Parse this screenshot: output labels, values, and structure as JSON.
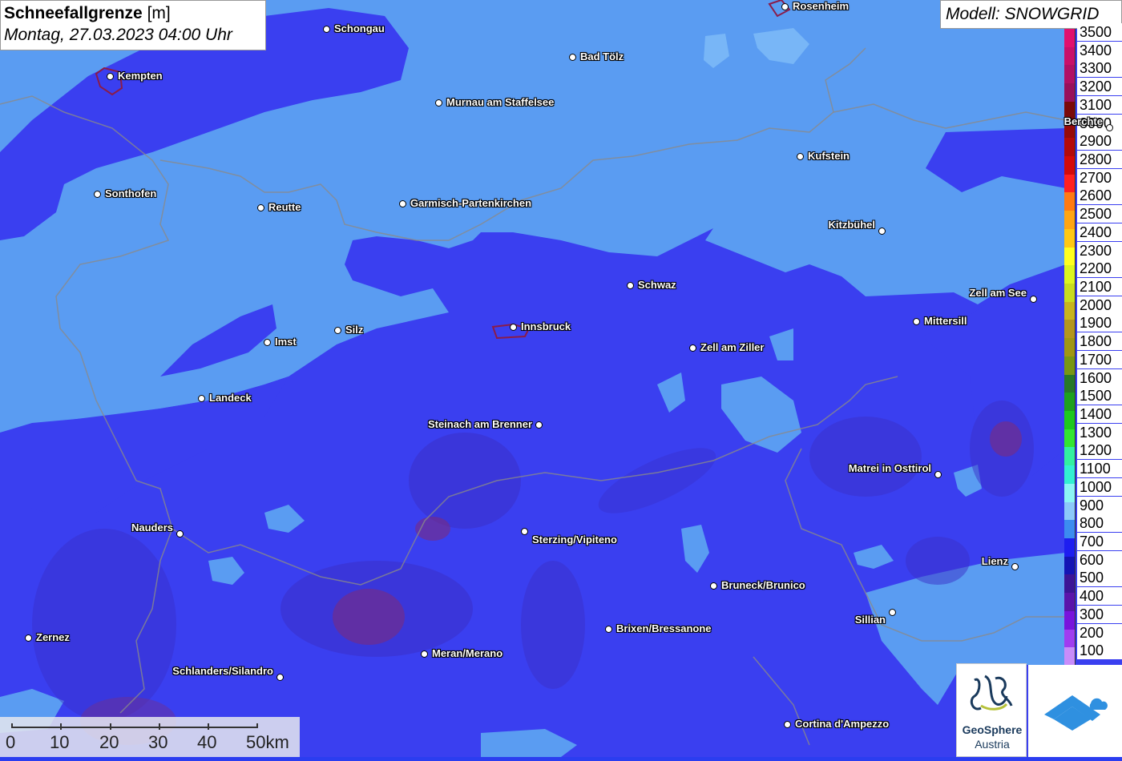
{
  "header": {
    "title_bold": "Schneefallgrenze",
    "title_unit": "[m]",
    "datetime": "Montag, 27.03.2023 04:00 Uhr",
    "model": "Modell: SNOWGRID"
  },
  "legend": {
    "items": [
      {
        "label": "3500",
        "color": "#e0116e"
      },
      {
        "label": "3400",
        "color": "#c8106a"
      },
      {
        "label": "3300",
        "color": "#b01066"
      },
      {
        "label": "3200",
        "color": "#98105c"
      },
      {
        "label": "3100",
        "color": "#7a0a0a"
      },
      {
        "label": "3000",
        "color": "#960a0a"
      },
      {
        "label": "2900",
        "color": "#b40a0a"
      },
      {
        "label": "2800",
        "color": "#d40a0a"
      },
      {
        "label": "2700",
        "color": "#ff2020"
      },
      {
        "label": "2600",
        "color": "#ff7a14"
      },
      {
        "label": "2500",
        "color": "#ffa514"
      },
      {
        "label": "2400",
        "color": "#ffc814"
      },
      {
        "label": "2300",
        "color": "#ffff1e"
      },
      {
        "label": "2200",
        "color": "#dcf51e"
      },
      {
        "label": "2100",
        "color": "#c8dc1e"
      },
      {
        "label": "2000",
        "color": "#c8b41e"
      },
      {
        "label": "1900",
        "color": "#b4961e"
      },
      {
        "label": "1800",
        "color": "#a09614"
      },
      {
        "label": "1700",
        "color": "#789614"
      },
      {
        "label": "1600",
        "color": "#287828"
      },
      {
        "label": "1500",
        "color": "#1ea01e"
      },
      {
        "label": "1400",
        "color": "#1ec81e"
      },
      {
        "label": "1300",
        "color": "#32e632"
      },
      {
        "label": "1200",
        "color": "#32f0a0"
      },
      {
        "label": "1100",
        "color": "#32f0d2"
      },
      {
        "label": "1000",
        "color": "#8cf5f5"
      },
      {
        "label": "900",
        "color": "#8cc8fa"
      },
      {
        "label": "800",
        "color": "#3c8cf0"
      },
      {
        "label": "700",
        "color": "#1e1ef0"
      },
      {
        "label": "600",
        "color": "#1414b4"
      },
      {
        "label": "500",
        "color": "#3c1496"
      },
      {
        "label": "400",
        "color": "#5a14aa"
      },
      {
        "label": "300",
        "color": "#7814dc"
      },
      {
        "label": "200",
        "color": "#a03cf0"
      },
      {
        "label": "100",
        "color": "#c88cfa"
      }
    ]
  },
  "cities": [
    {
      "name": "Rosenheim",
      "label_side": "right"
    },
    {
      "name": "Schongau",
      "label_side": "right"
    },
    {
      "name": "Kempten",
      "label_side": "right"
    },
    {
      "name": "Bad Tölz",
      "label_side": "right"
    },
    {
      "name": "Murnau am Staffelsee",
      "label_side": "right"
    },
    {
      "name": "Berchte",
      "label_side": "left"
    },
    {
      "name": "Kufstein",
      "label_side": "right"
    },
    {
      "name": "Sonthofen",
      "label_side": "right"
    },
    {
      "name": "Reutte",
      "label_side": "right"
    },
    {
      "name": "Garmisch-Partenkirchen",
      "label_side": "right"
    },
    {
      "name": "Kitzbühel",
      "label_side": "left"
    },
    {
      "name": "Schwaz",
      "label_side": "right"
    },
    {
      "name": "Zell am See",
      "label_side": "left"
    },
    {
      "name": "Mittersill",
      "label_side": "right"
    },
    {
      "name": "Innsbruck",
      "label_side": "right"
    },
    {
      "name": "Silz",
      "label_side": "right"
    },
    {
      "name": "Imst",
      "label_side": "right"
    },
    {
      "name": "Zell am Ziller",
      "label_side": "right"
    },
    {
      "name": "Landeck",
      "label_side": "right"
    },
    {
      "name": "Steinach am Brenner",
      "label_side": "left"
    },
    {
      "name": "Matrei in Osttirol",
      "label_side": "left"
    },
    {
      "name": "Nauders",
      "label_side": "left"
    },
    {
      "name": "Sterzing/Vipiteno",
      "label_side": "right"
    },
    {
      "name": "Lienz",
      "label_side": "left"
    },
    {
      "name": "Bruneck/Brunico",
      "label_side": "right"
    },
    {
      "name": "Sillian",
      "label_side": "left"
    },
    {
      "name": "Brixen/Bressanone",
      "label_side": "right"
    },
    {
      "name": "Zernez",
      "label_side": "right"
    },
    {
      "name": "Meran/Merano",
      "label_side": "right"
    },
    {
      "name": "Schlanders/Silandro",
      "label_side": "left"
    },
    {
      "name": "Cortina d'Ampezzo",
      "label_side": "right"
    }
  ],
  "scale": {
    "labels": [
      "0",
      "10",
      "20",
      "30",
      "40",
      "50km"
    ]
  },
  "logos": {
    "geosphere_line1": "GeoSphere",
    "geosphere_line2": "Austria"
  }
}
